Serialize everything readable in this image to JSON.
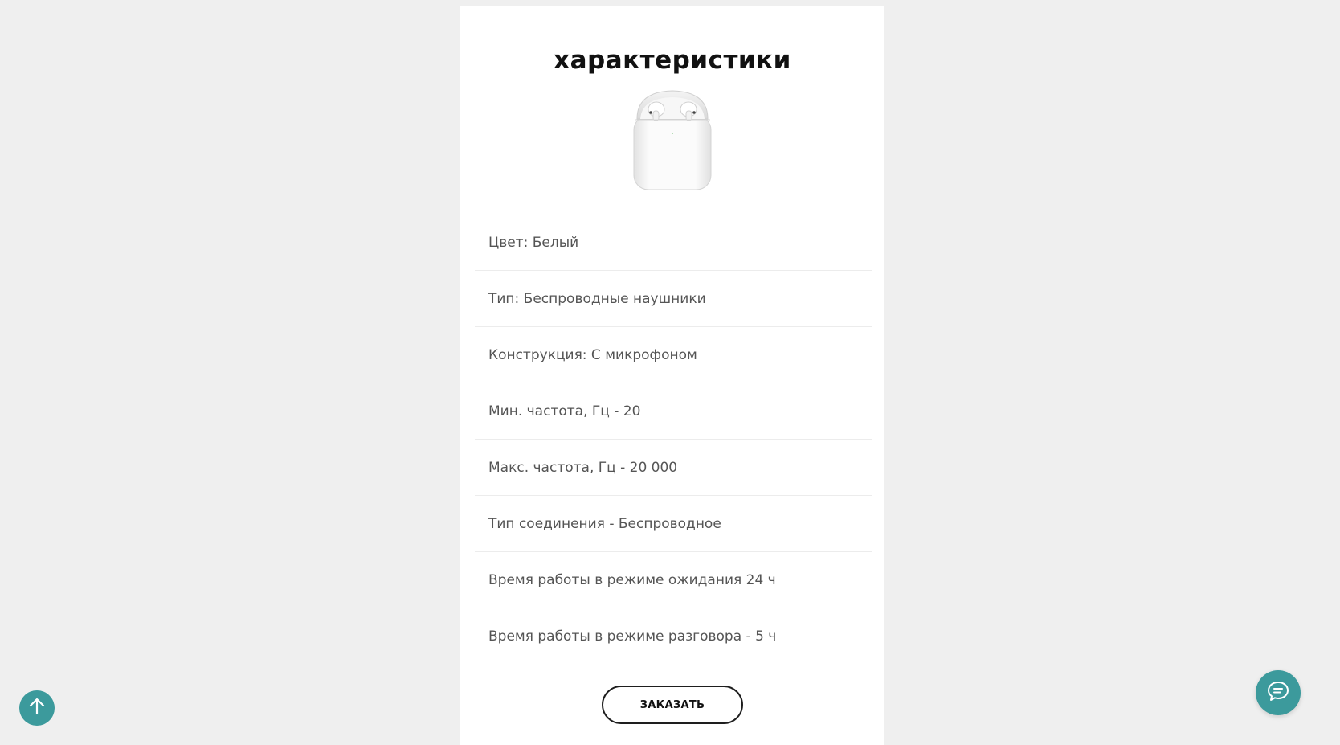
{
  "page": {
    "title": "характеристики"
  },
  "product": {
    "image_icon": "airpods-case-icon"
  },
  "specs": [
    "Цвет: Белый",
    "Тип: Беспроводные наушники",
    "Конструкция: С микрофоном",
    "Мин. частота, Гц - 20",
    "Макс. частота, Гц - 20 000",
    "Тип соединения - Беспроводное",
    "Время работы в режиме ожидания 24 ч",
    "Время работы в режиме разговора - 5 ч"
  ],
  "actions": {
    "order_label": "ЗАКАЗАТЬ"
  },
  "floating": {
    "scroll_top_icon": "arrow-up-icon",
    "chat_icon": "chat-bubble-icon"
  },
  "colors": {
    "accent": "#3c9a9c",
    "background": "#efefef",
    "card": "#ffffff"
  }
}
